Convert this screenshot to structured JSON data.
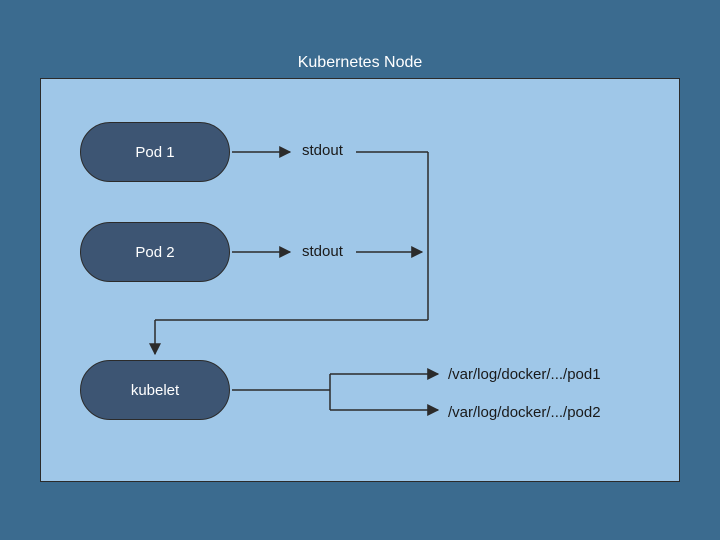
{
  "diagram": {
    "title": "Kubernetes Node",
    "nodes": {
      "pod1": "Pod 1",
      "pod2": "Pod 2",
      "kubelet": "kubelet"
    },
    "labels": {
      "stdout1": "stdout",
      "stdout2": "stdout",
      "logpath1": "/var/log/docker/.../pod1",
      "logpath2": "/var/log/docker/.../pod2"
    }
  }
}
